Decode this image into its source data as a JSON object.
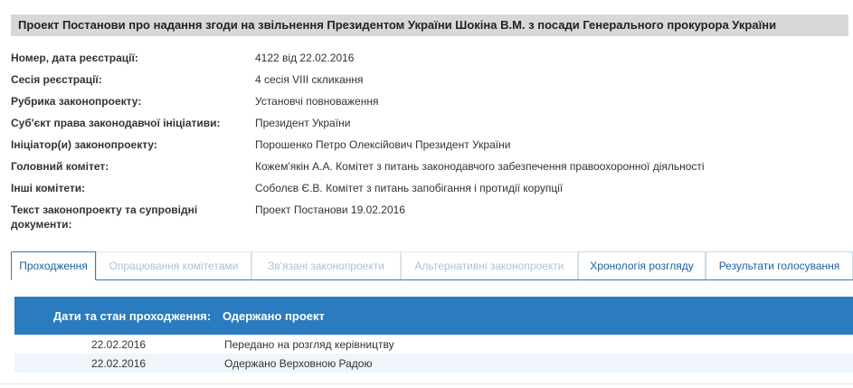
{
  "header": {
    "title": "Проект Постанови про надання згоди на звільнення Президентом України Шокіна В.М. з посади Генерального прокурора України"
  },
  "info": {
    "rows": [
      {
        "label": "Номер, дата реєстрації:",
        "value": "4122 від 22.02.2016"
      },
      {
        "label": "Сесія реєстрації:",
        "value": "4 сесія VIII скликання"
      },
      {
        "label": "Рубрика законопроекту:",
        "value": "Установчі повноваження"
      },
      {
        "label": "Суб'єкт права законодавчої ініціативи:",
        "value": "Президент України"
      },
      {
        "label": "Ініціатор(и) законопроекту:",
        "value": "Порошенко Петро Олексійович Президент України"
      },
      {
        "label": "Головний комітет:",
        "value": "Кожем'якін А.А. Комітет з питань законодавчого забезпечення правоохоронної діяльності"
      },
      {
        "label": "Інші комітети:",
        "value": "Соболєв Є.В. Комітет з питань запобігання і протидії корупції"
      },
      {
        "label": "Текст законопроекту та супровідні документи:",
        "value": "Проект Постанови 19.02.2016"
      }
    ]
  },
  "tabs": [
    {
      "label": "Проходження",
      "state": "active"
    },
    {
      "label": "Опрацювання комітетами",
      "state": "disabled"
    },
    {
      "label": "Зв'язані законопроекти",
      "state": "disabled"
    },
    {
      "label": "Альтернативні законопроекти",
      "state": "disabled"
    },
    {
      "label": "Хронологія розгляду",
      "state": "enabled"
    },
    {
      "label": "Результати голосування",
      "state": "enabled"
    }
  ],
  "table": {
    "header_date": "Дати та стан проходження:",
    "header_status": "Одержано проект",
    "rows": [
      {
        "date": "22.02.2016",
        "text": "Передано на розгляд керівництву"
      },
      {
        "date": "22.02.2016",
        "text": "Одержано Верховною Радою"
      }
    ]
  },
  "colors": {
    "accent": "#2a7bbf",
    "title_bg": "#d8d8d8",
    "row_alt": "#eef5fb"
  }
}
